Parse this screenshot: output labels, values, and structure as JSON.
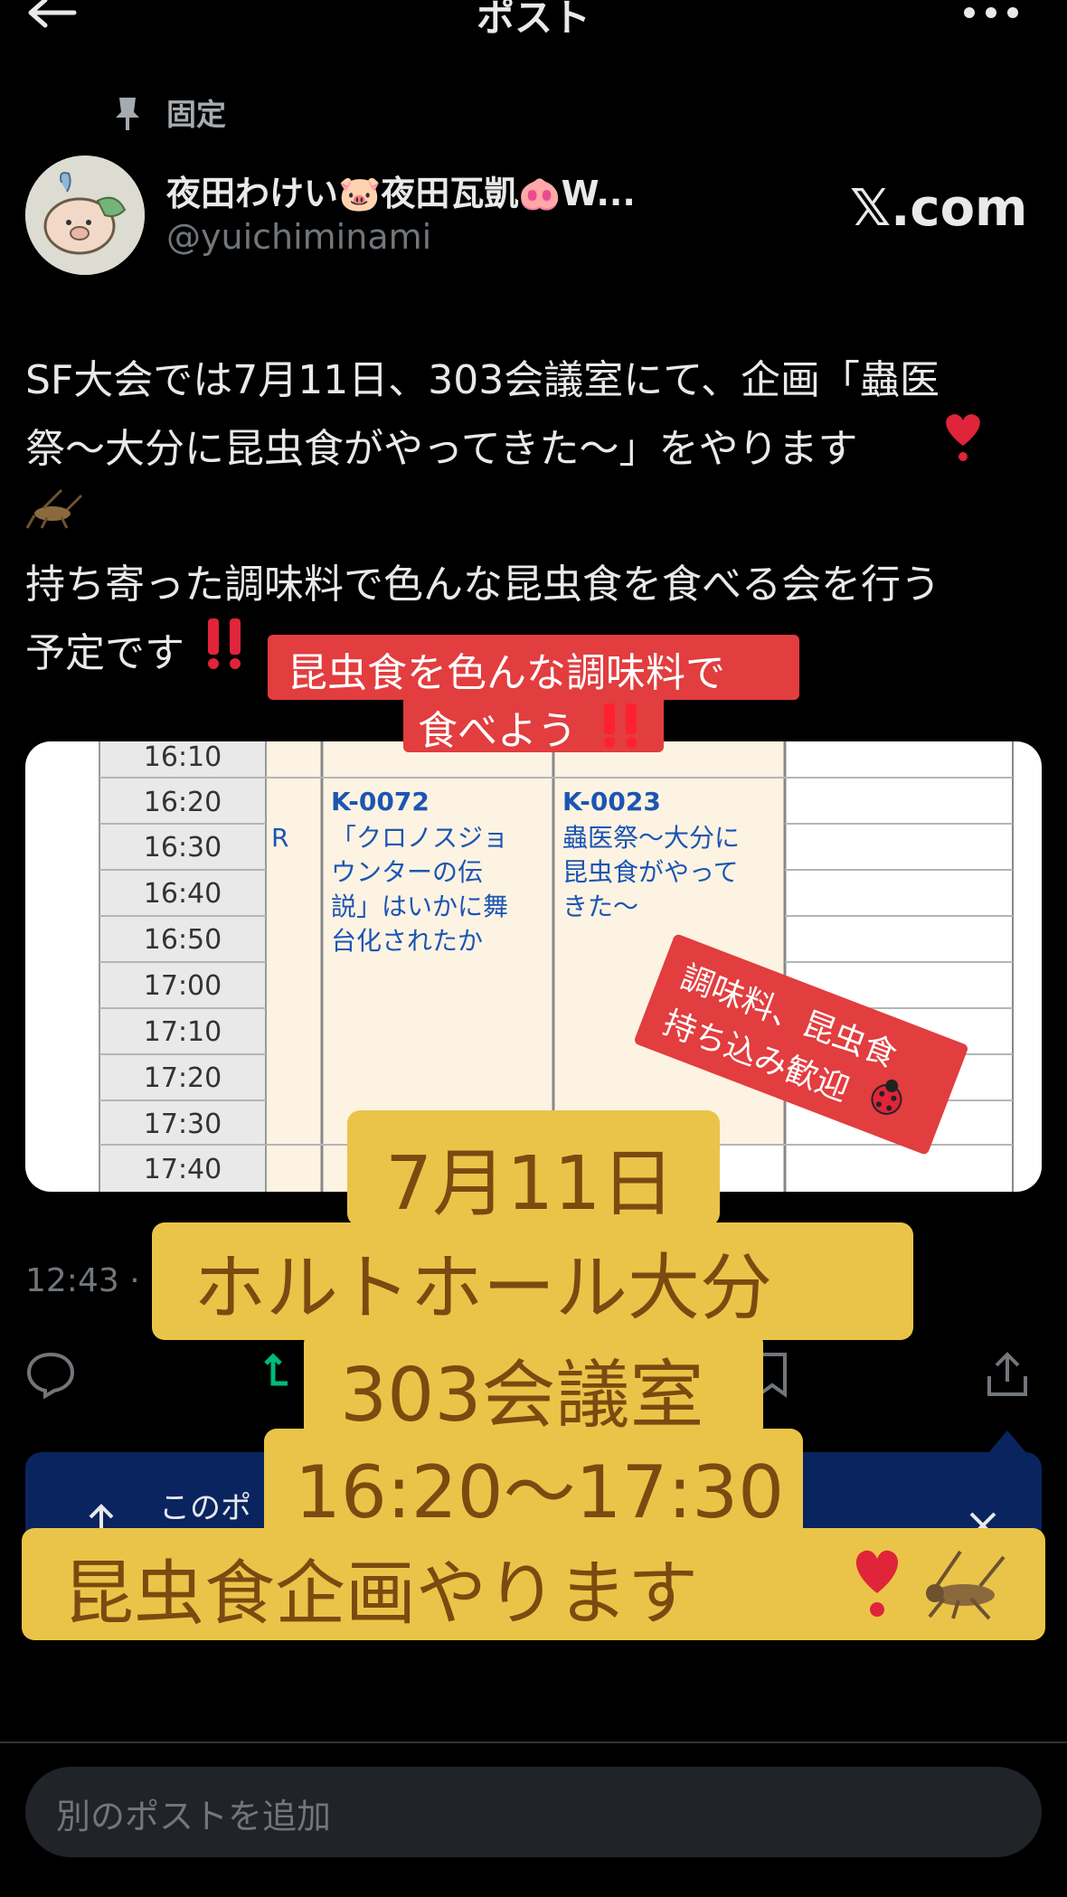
{
  "header": {
    "title": "ポスト"
  },
  "pinned": {
    "label": "固定"
  },
  "author": {
    "display_name": "夜田わけい🐷夜田瓦凱🐽W...",
    "handle": "@yuichiminami",
    "badge": "𝕏.com"
  },
  "post": {
    "lines": [
      "SF大会では7月11日、303会議室にて、企画「蟲医",
      "祭〜大分に昆虫食がやってきた〜」をやります",
      "持ち寄った調味料で色んな昆虫食を食べる会を行う",
      "予定です"
    ]
  },
  "overlay_red": {
    "line1": "昆虫食を色んな調味料で",
    "line2": "食べよう"
  },
  "schedule": {
    "times": [
      "16:10",
      "16:20",
      "16:30",
      "16:40",
      "16:50",
      "17:00",
      "17:10",
      "17:20",
      "17:30",
      "17:40"
    ],
    "col_r_letter": "R",
    "event1": {
      "code": "K-0072",
      "lines": [
        "「クロノスジョ",
        "ウンターの伝",
        "説」はいかに舞",
        "台化されたか"
      ]
    },
    "event2": {
      "code": "K-0023",
      "lines": [
        "蟲医祭〜大分に",
        "昆虫食がやって",
        "きた〜"
      ]
    }
  },
  "overlay_diagonal": {
    "line1": "調味料、昆虫食",
    "line2": "持ち込み歓迎"
  },
  "meta": {
    "timestamp": "12:43 ·"
  },
  "promo": {
    "text": "このポ                                             にも共有"
  },
  "overlay_yellow": {
    "date": "7月11日",
    "venue": "ホルトホール大分",
    "room": "303会議室",
    "time": "16:20〜17:30",
    "tagline": "昆虫食企画やります"
  },
  "reply": {
    "placeholder": "別のポストを追加"
  },
  "colors": {
    "accent_red": "#e23d3f",
    "accent_yellow": "#eac449",
    "promo_blue": "#0a2460",
    "retweet_green": "#00ba7c"
  }
}
